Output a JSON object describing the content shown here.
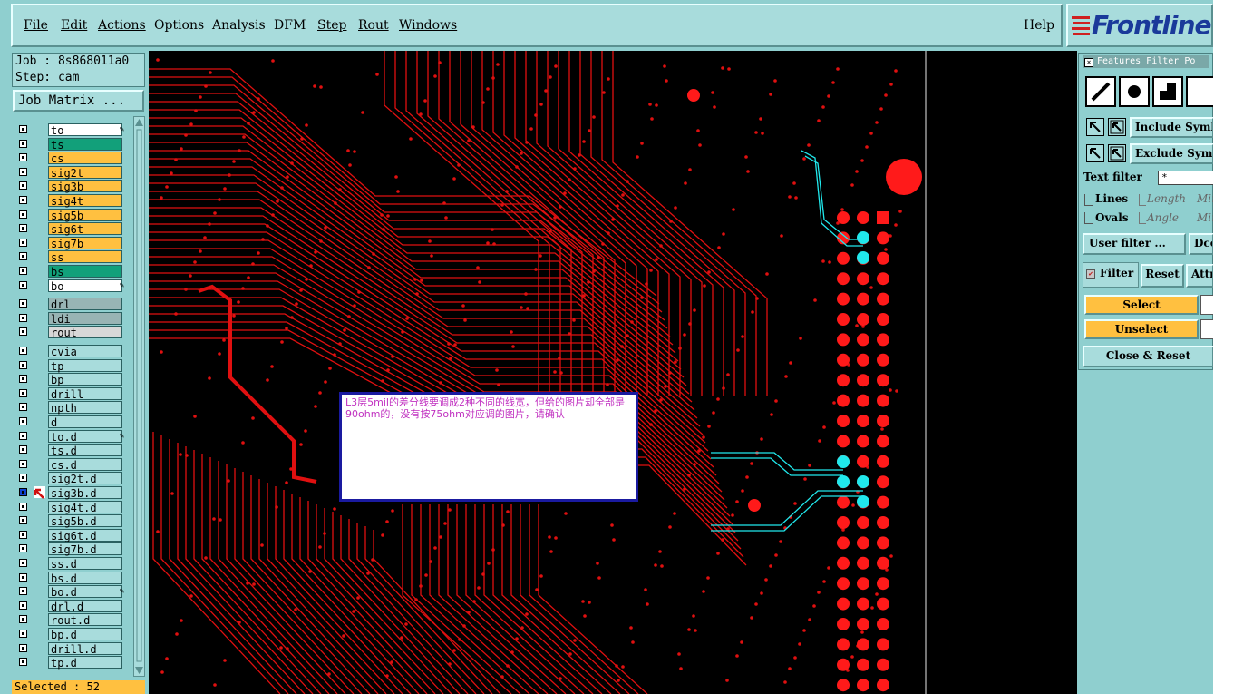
{
  "menu": {
    "items": [
      "File",
      "Edit",
      "Actions",
      "Options",
      "Analysis",
      "DFM",
      "Step",
      "Rout",
      "Windows"
    ],
    "help": "Help"
  },
  "logo": {
    "text": "Frontline"
  },
  "job": {
    "job_label": "Job : 8s868011a0",
    "step_label": "Step: cam",
    "matrix_button": "Job Matrix ..."
  },
  "layers": [
    {
      "name": "to",
      "color": "#ffffff",
      "edit": true
    },
    {
      "name": "ts",
      "color": "#12a07a"
    },
    {
      "name": "cs",
      "color": "#ffc040"
    },
    {
      "name": "sig2t",
      "color": "#ffc040"
    },
    {
      "name": "sig3b",
      "color": "#ffc040"
    },
    {
      "name": "sig4t",
      "color": "#ffc040"
    },
    {
      "name": "sig5b",
      "color": "#ffc040"
    },
    {
      "name": "sig6t",
      "color": "#ffc040"
    },
    {
      "name": "sig7b",
      "color": "#ffc040"
    },
    {
      "name": "ss",
      "color": "#ffc040"
    },
    {
      "name": "bs",
      "color": "#12a07a"
    },
    {
      "name": "bo",
      "color": "#ffffff",
      "edit": true
    },
    {
      "name": "drl",
      "color": "#98b4b4",
      "gap": true
    },
    {
      "name": "ldi",
      "color": "#98b4b4"
    },
    {
      "name": "rout",
      "color": "#d8d8d8"
    },
    {
      "name": "cvia",
      "color": "#a8dcdc",
      "gap": true
    },
    {
      "name": "tp",
      "color": "#a8dcdc"
    },
    {
      "name": "bp",
      "color": "#a8dcdc"
    },
    {
      "name": "drill",
      "color": "#a8dcdc"
    },
    {
      "name": "npth",
      "color": "#a8dcdc"
    },
    {
      "name": "d",
      "color": "#a8dcdc"
    },
    {
      "name": "to.d",
      "color": "#a8dcdc",
      "edit": true
    },
    {
      "name": "ts.d",
      "color": "#a8dcdc"
    },
    {
      "name": "cs.d",
      "color": "#a8dcdc"
    },
    {
      "name": "sig2t.d",
      "color": "#a8dcdc"
    },
    {
      "name": "sig3b.d",
      "color": "#a8dcdc",
      "active": true
    },
    {
      "name": "sig4t.d",
      "color": "#a8dcdc"
    },
    {
      "name": "sig5b.d",
      "color": "#a8dcdc"
    },
    {
      "name": "sig6t.d",
      "color": "#a8dcdc"
    },
    {
      "name": "sig7b.d",
      "color": "#a8dcdc"
    },
    {
      "name": "ss.d",
      "color": "#a8dcdc"
    },
    {
      "name": "bs.d",
      "color": "#a8dcdc"
    },
    {
      "name": "bo.d",
      "color": "#a8dcdc",
      "edit": true
    },
    {
      "name": "drl.d",
      "color": "#a8dcdc"
    },
    {
      "name": "rout.d",
      "color": "#a8dcdc"
    },
    {
      "name": "bp.d",
      "color": "#a8dcdc"
    },
    {
      "name": "drill.d",
      "color": "#a8dcdc"
    },
    {
      "name": "tp.d",
      "color": "#a8dcdc"
    }
  ],
  "status": {
    "selected": "Selected : 52"
  },
  "note": {
    "text": "L3层5mil的差分线要调成2种不同的线宽，但给的图片却全部是90ohm的，没有按75ohm对应调的图片，请确认"
  },
  "filter": {
    "title": "Features Filter Po",
    "include": "Include Symb",
    "exclude": "Exclude Symb",
    "text_filter": "Text filter",
    "text_filter_value": "*",
    "lines": "Lines",
    "ovals": "Ovals",
    "length": "Length",
    "angle": "Angle",
    "min1": "Min",
    "min2": "Min",
    "user_filter": "User filter ...",
    "dcode": "Dco",
    "filter": "Filter",
    "reset": "Reset",
    "attr": "Attr",
    "select": "Select",
    "unselect": "Unselect",
    "close_reset": "Close & Reset"
  },
  "colors": {
    "trace": "#e01010",
    "pad": "#ff1a1a",
    "selected": "#20e8ec",
    "background": "#000000"
  }
}
